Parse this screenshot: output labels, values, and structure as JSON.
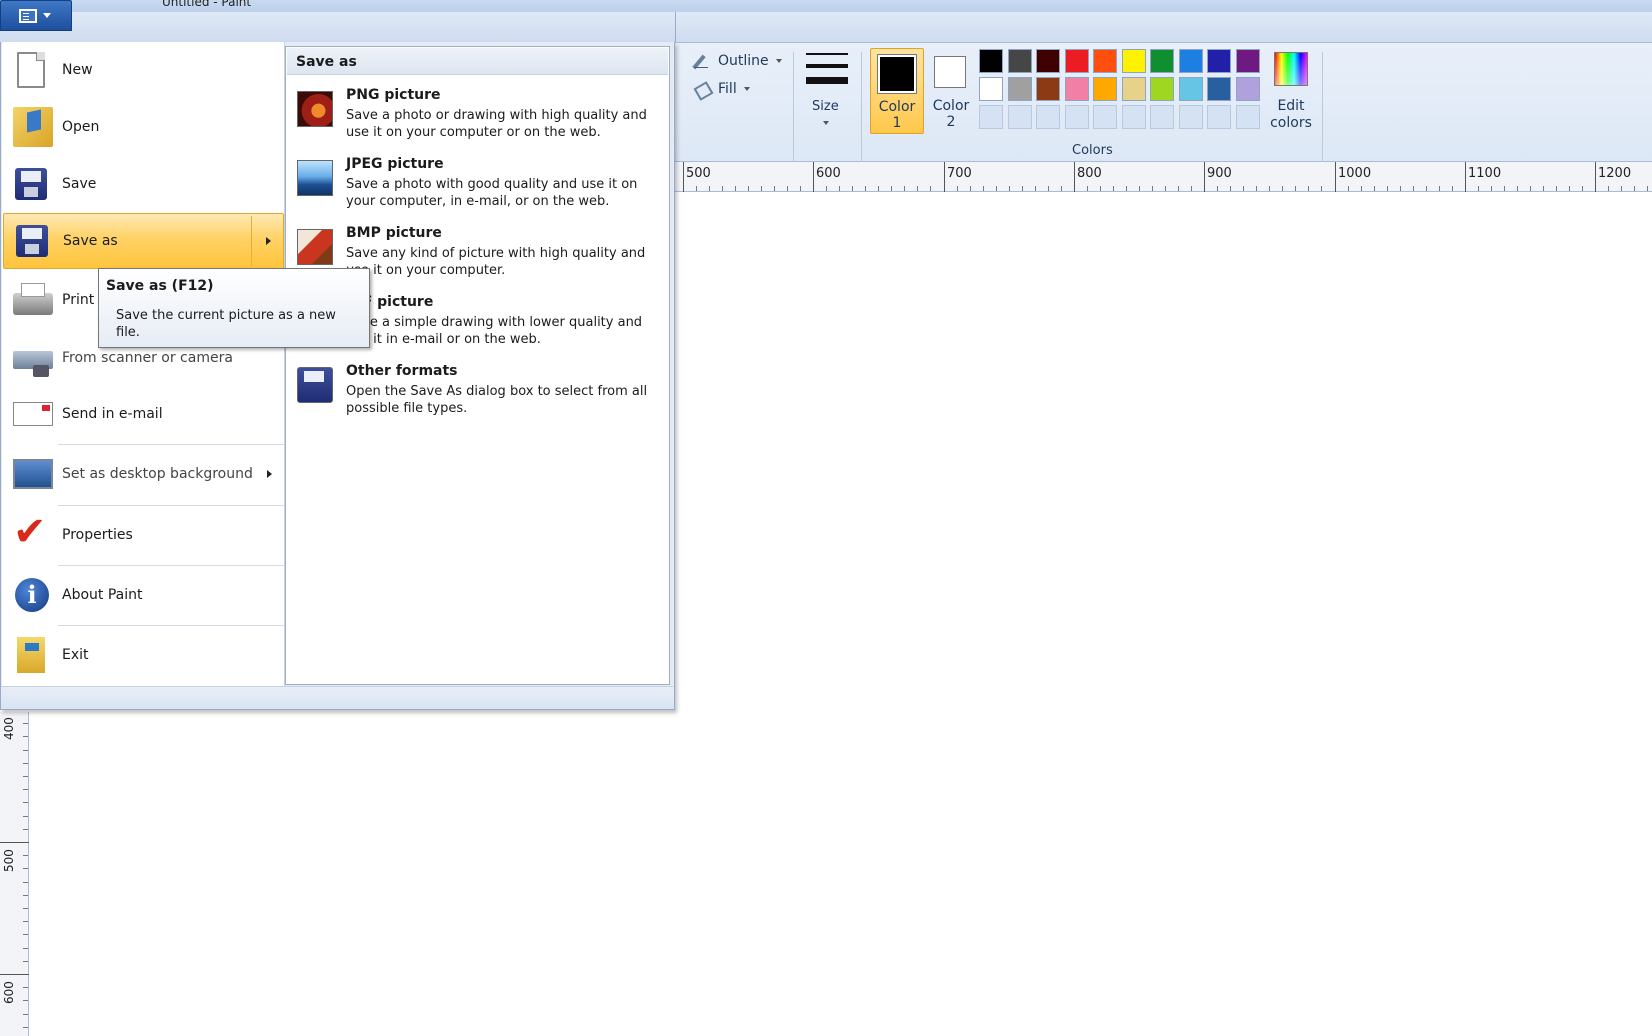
{
  "window": {
    "title": "Untitled - Paint"
  },
  "ribbon": {
    "outline_label": "Outline",
    "fill_label": "Fill",
    "size_label": "Size",
    "color1_label": "Color\n1",
    "color2_label": "Color\n2",
    "colors_group_label": "Colors",
    "edit_colors_label": "Edit\ncolors",
    "color1_value": "#000000",
    "color2_value": "#ffffff",
    "palette_row1": [
      "#000000",
      "#464646",
      "#3f0000",
      "#ec1c24",
      "#ff4f0f",
      "#fff200",
      "#0f8f2f",
      "#1d7fe2",
      "#2220a8",
      "#6f1a80"
    ],
    "palette_row2": [
      "#ffffff",
      "#a0a0a0",
      "#8b3a14",
      "#f27fa5",
      "#ffa800",
      "#e8d28a",
      "#9ed620",
      "#66c5e4",
      "#275fa0",
      "#b0a1dd"
    ],
    "palette_row3_empty": 10
  },
  "ruler": {
    "horizontal_labels": [
      "500",
      "600",
      "700",
      "800",
      "900",
      "1000",
      "1100",
      "1200"
    ],
    "vertical_labels": [
      "400",
      "500",
      "600"
    ]
  },
  "menu": {
    "items": [
      {
        "label": "New"
      },
      {
        "label": "Open"
      },
      {
        "label": "Save"
      },
      {
        "label": "Save as"
      },
      {
        "label": "Print"
      },
      {
        "label": "From scanner or camera"
      },
      {
        "label": "Send in e-mail"
      },
      {
        "label": "Set as desktop background"
      },
      {
        "label": "Properties"
      },
      {
        "label": "About Paint"
      },
      {
        "label": "Exit"
      }
    ]
  },
  "submenu": {
    "header": "Save as",
    "items": [
      {
        "title": "PNG picture",
        "desc": "Save a photo or drawing with high quality and use it on your computer or on the web."
      },
      {
        "title": "JPEG picture",
        "desc": "Save a photo with good quality and use it on your computer, in e-mail, or on the web."
      },
      {
        "title": "BMP picture",
        "desc": "Save any kind of picture with high quality and use it on your computer."
      },
      {
        "title": "GIF picture",
        "desc": "Save a simple drawing with lower quality and use it in e-mail or on the web."
      },
      {
        "title": "Other formats",
        "desc": "Open the Save As dialog box to select from all possible file types."
      }
    ]
  },
  "tooltip": {
    "title": "Save as (F12)",
    "text": "Save the current picture as a new file."
  }
}
